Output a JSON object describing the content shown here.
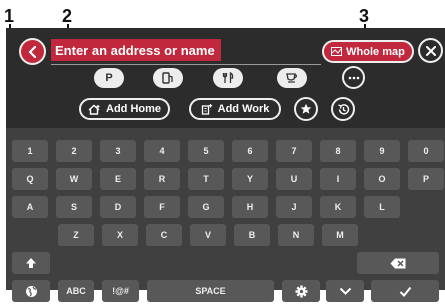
{
  "callouts": [
    "1",
    "2",
    "3"
  ],
  "search": {
    "placeholder": "Enter an address or name"
  },
  "whole_map_label": "Whole map",
  "poi": {
    "parking_label": "P"
  },
  "add_home_label": "Add Home",
  "add_work_label": "Add Work",
  "keyboard": {
    "row1": [
      "1",
      "2",
      "3",
      "4",
      "5",
      "6",
      "7",
      "8",
      "9",
      "0"
    ],
    "row2": [
      "Q",
      "W",
      "E",
      "R",
      "T",
      "Y",
      "U",
      "I",
      "O",
      "P"
    ],
    "row3": [
      "A",
      "S",
      "D",
      "F",
      "G",
      "H",
      "J",
      "K",
      "L"
    ],
    "row4": [
      "Z",
      "X",
      "C",
      "V",
      "B",
      "N",
      "M"
    ],
    "abc_label": "ABC",
    "symbols_label": "!@#",
    "space_label": "SPACE"
  },
  "colors": {
    "accent": "#c1283d",
    "panel": "#2c2c2c",
    "keyboard_bg": "#404040",
    "key_bg": "#585858"
  },
  "icons": {
    "back": "chevron-left-icon",
    "whole_map": "map-icon",
    "close": "close-icon",
    "poi": [
      "parking-icon",
      "fuel-icon",
      "restaurant-icon",
      "cafe-icon"
    ],
    "more": "more-icon",
    "add_home": "home-add-icon",
    "add_work": "building-add-icon",
    "favorites": "star-icon",
    "recent": "history-icon",
    "shift": "shift-arrow-icon",
    "backspace": "backspace-icon",
    "globe": "globe-icon",
    "settings": "gear-icon",
    "hide_keyboard": "chevron-down-icon",
    "confirm": "checkmark-icon"
  }
}
